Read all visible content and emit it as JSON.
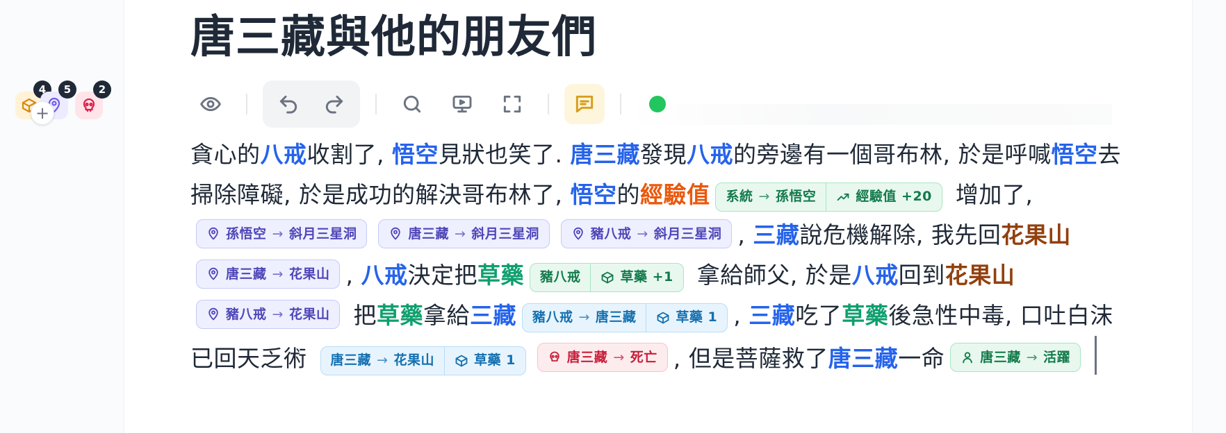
{
  "title": "唐三藏與他的朋友們",
  "sidebar": {
    "badges": [
      {
        "icon": "box-icon",
        "count": "4",
        "color": "#d68a12"
      },
      {
        "icon": "map-pin-icon",
        "count": "5",
        "color": "#6d5ce8"
      },
      {
        "icon": "skull-icon",
        "count": "2",
        "color": "#e11d48"
      }
    ],
    "add_symbol": "+"
  },
  "toolbar": {
    "buttons": [
      "eye-icon",
      "undo-icon",
      "redo-icon",
      "search-icon",
      "present-icon",
      "fullscreen-icon",
      "comment-icon"
    ],
    "status_color": "#22c55e"
  },
  "story": {
    "t1": "貪心的",
    "c1": "八戒",
    "t2": "收割了, ",
    "c2": "悟空",
    "t3": "見狀也笑了. ",
    "c3": "唐三藏",
    "t4": "發現",
    "c4": "八戒",
    "t5": "的旁邊有一個哥布林, 於是呼喊",
    "c5": "悟空",
    "t6": "去掃除障礙, 於是成功的解決哥布林了, ",
    "c6": "悟空",
    "t7": "的",
    "s1": "經驗值",
    "p1": {
      "from": "系統",
      "to": "孫悟空",
      "stat": "經驗值 +20"
    },
    "t8": " 增加了, ",
    "m1": {
      "from": "孫悟空",
      "to": "斜月三星洞"
    },
    "m2": {
      "from": "唐三藏",
      "to": "斜月三星洞"
    },
    "m3": {
      "from": "豬八戒",
      "to": "斜月三星洞"
    },
    "t9": ", ",
    "c7": "三藏",
    "t10": "說危機解除, 我先回",
    "pl1": "花果山",
    "m4": {
      "from": "唐三藏",
      "to": "花果山"
    },
    "t11": ", ",
    "c8": "八戒",
    "t12": "決定把",
    "i1": "草藥",
    "p2": {
      "from": "豬八戒",
      "item": "草藥 +1"
    },
    "t13": " 拿給師父, 於是",
    "c9": "八戒",
    "t14": "回到",
    "pl2": "花果山",
    "m5": {
      "from": "豬八戒",
      "to": "花果山"
    },
    "t15": " 把",
    "i2": "草藥",
    "t16": "拿給",
    "c10": "三藏",
    "p3": {
      "from": "豬八戒",
      "to": "唐三藏",
      "item": "草藥 1"
    },
    "t17": ", ",
    "c11": "三藏",
    "t18": "吃了",
    "i3": "草藥",
    "t19": "後急性中毒, 口吐白沫已回天乏術 ",
    "p4": {
      "from": "唐三藏",
      "to": "花果山",
      "item": "草藥 1"
    },
    "d1": {
      "who": "唐三藏",
      "state": "死亡"
    },
    "t20": ", 但是菩薩救了",
    "c12": "唐三藏",
    "t21": "一命",
    "a1": {
      "who": "唐三藏",
      "state": "活躍"
    }
  }
}
